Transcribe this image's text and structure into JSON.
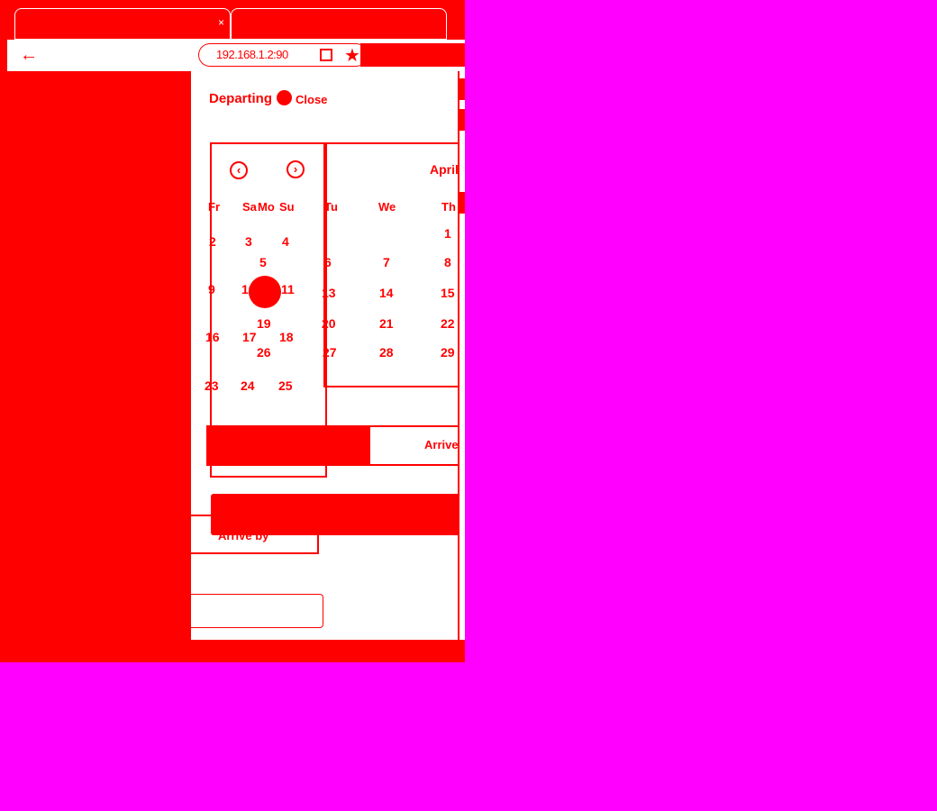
{
  "browser": {
    "tabs": [
      {
        "label": "",
        "close_icon": "×"
      },
      {
        "label": ""
      }
    ],
    "back_icon": "←",
    "url": "192.168.1.2:90",
    "bookmark_icon": "★"
  },
  "panel": {
    "heading": "Departing",
    "close_label": "Close",
    "prev_icon": "‹",
    "next_icon": "›",
    "month_title": "April",
    "weekdays_left": [
      "Fr",
      "Sa",
      "Mo",
      "Su"
    ],
    "weekdays_right": [
      "Tu",
      "We",
      "Th"
    ],
    "days": [
      "1",
      "2",
      "3",
      "4",
      "5",
      "6",
      "7",
      "8",
      "9",
      "10",
      "11",
      "13",
      "14",
      "15",
      "16",
      "17",
      "18",
      "19",
      "20",
      "21",
      "22",
      "23",
      "24",
      "25",
      "26",
      "27",
      "28",
      "29"
    ],
    "selected_day": "10",
    "segment": {
      "depart_label": "",
      "arrive_label": "Arrive I"
    },
    "secondary_label": "Arrive by"
  },
  "colors": {
    "accent": "#ff0000",
    "background": "#ff00ff",
    "surface": "#ffffff"
  }
}
